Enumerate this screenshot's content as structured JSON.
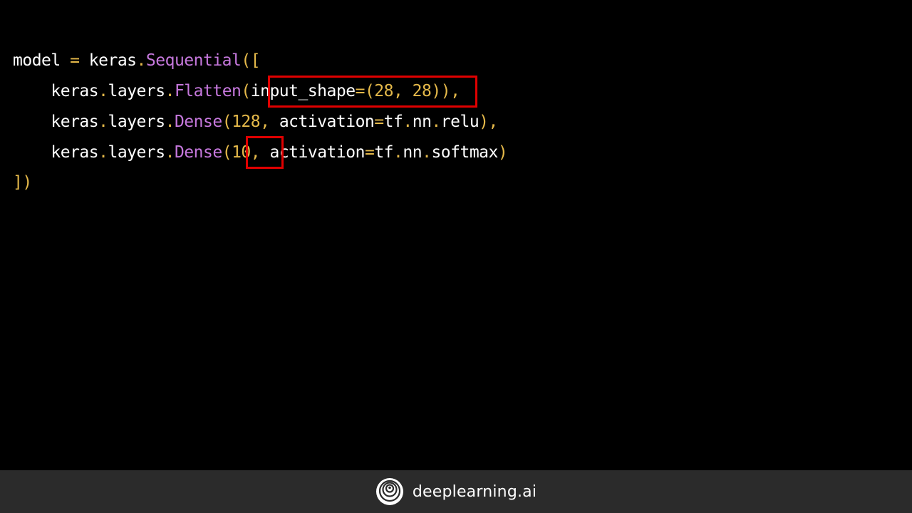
{
  "code": {
    "line1": {
      "model": "model",
      "eq": " = ",
      "keras": "keras",
      "dot": ".",
      "seq": "Sequential",
      "open": "(["
    },
    "line2": {
      "keras": "keras",
      "dot1": ".",
      "layers": "layers",
      "dot2": ".",
      "fn": "Flatten",
      "open": "(",
      "arg_name": "input_shape",
      "eq": "=",
      "arg_val": "(28, 28)",
      "close": "),"
    },
    "line3": {
      "keras": "keras",
      "dot1": ".",
      "layers": "layers",
      "dot2": ".",
      "fn": "Dense",
      "open": "(",
      "units": "128",
      "comma": ", ",
      "act": "activation",
      "eq": "=",
      "tf": "tf",
      "dot3": ".",
      "nn": "nn",
      "dot4": ".",
      "relu": "relu",
      "close": "),"
    },
    "line4": {
      "keras": "keras",
      "dot1": ".",
      "layers": "layers",
      "dot2": ".",
      "fn": "Dense",
      "open": "(",
      "units": "10",
      "comma": ", ",
      "act": "activation",
      "eq": "=",
      "tf": "tf",
      "dot3": ".",
      "nn": "nn",
      "dot4": ".",
      "softmax": "softmax",
      "close": ")"
    },
    "line5": {
      "close": "])"
    }
  },
  "colors": {
    "highlight_box": "#e00000",
    "function": "#c678dd",
    "operator": "#e5b94a"
  },
  "footer": {
    "brand": "deeplearning.ai",
    "logo_icon": "deeplearning-logo-icon"
  }
}
